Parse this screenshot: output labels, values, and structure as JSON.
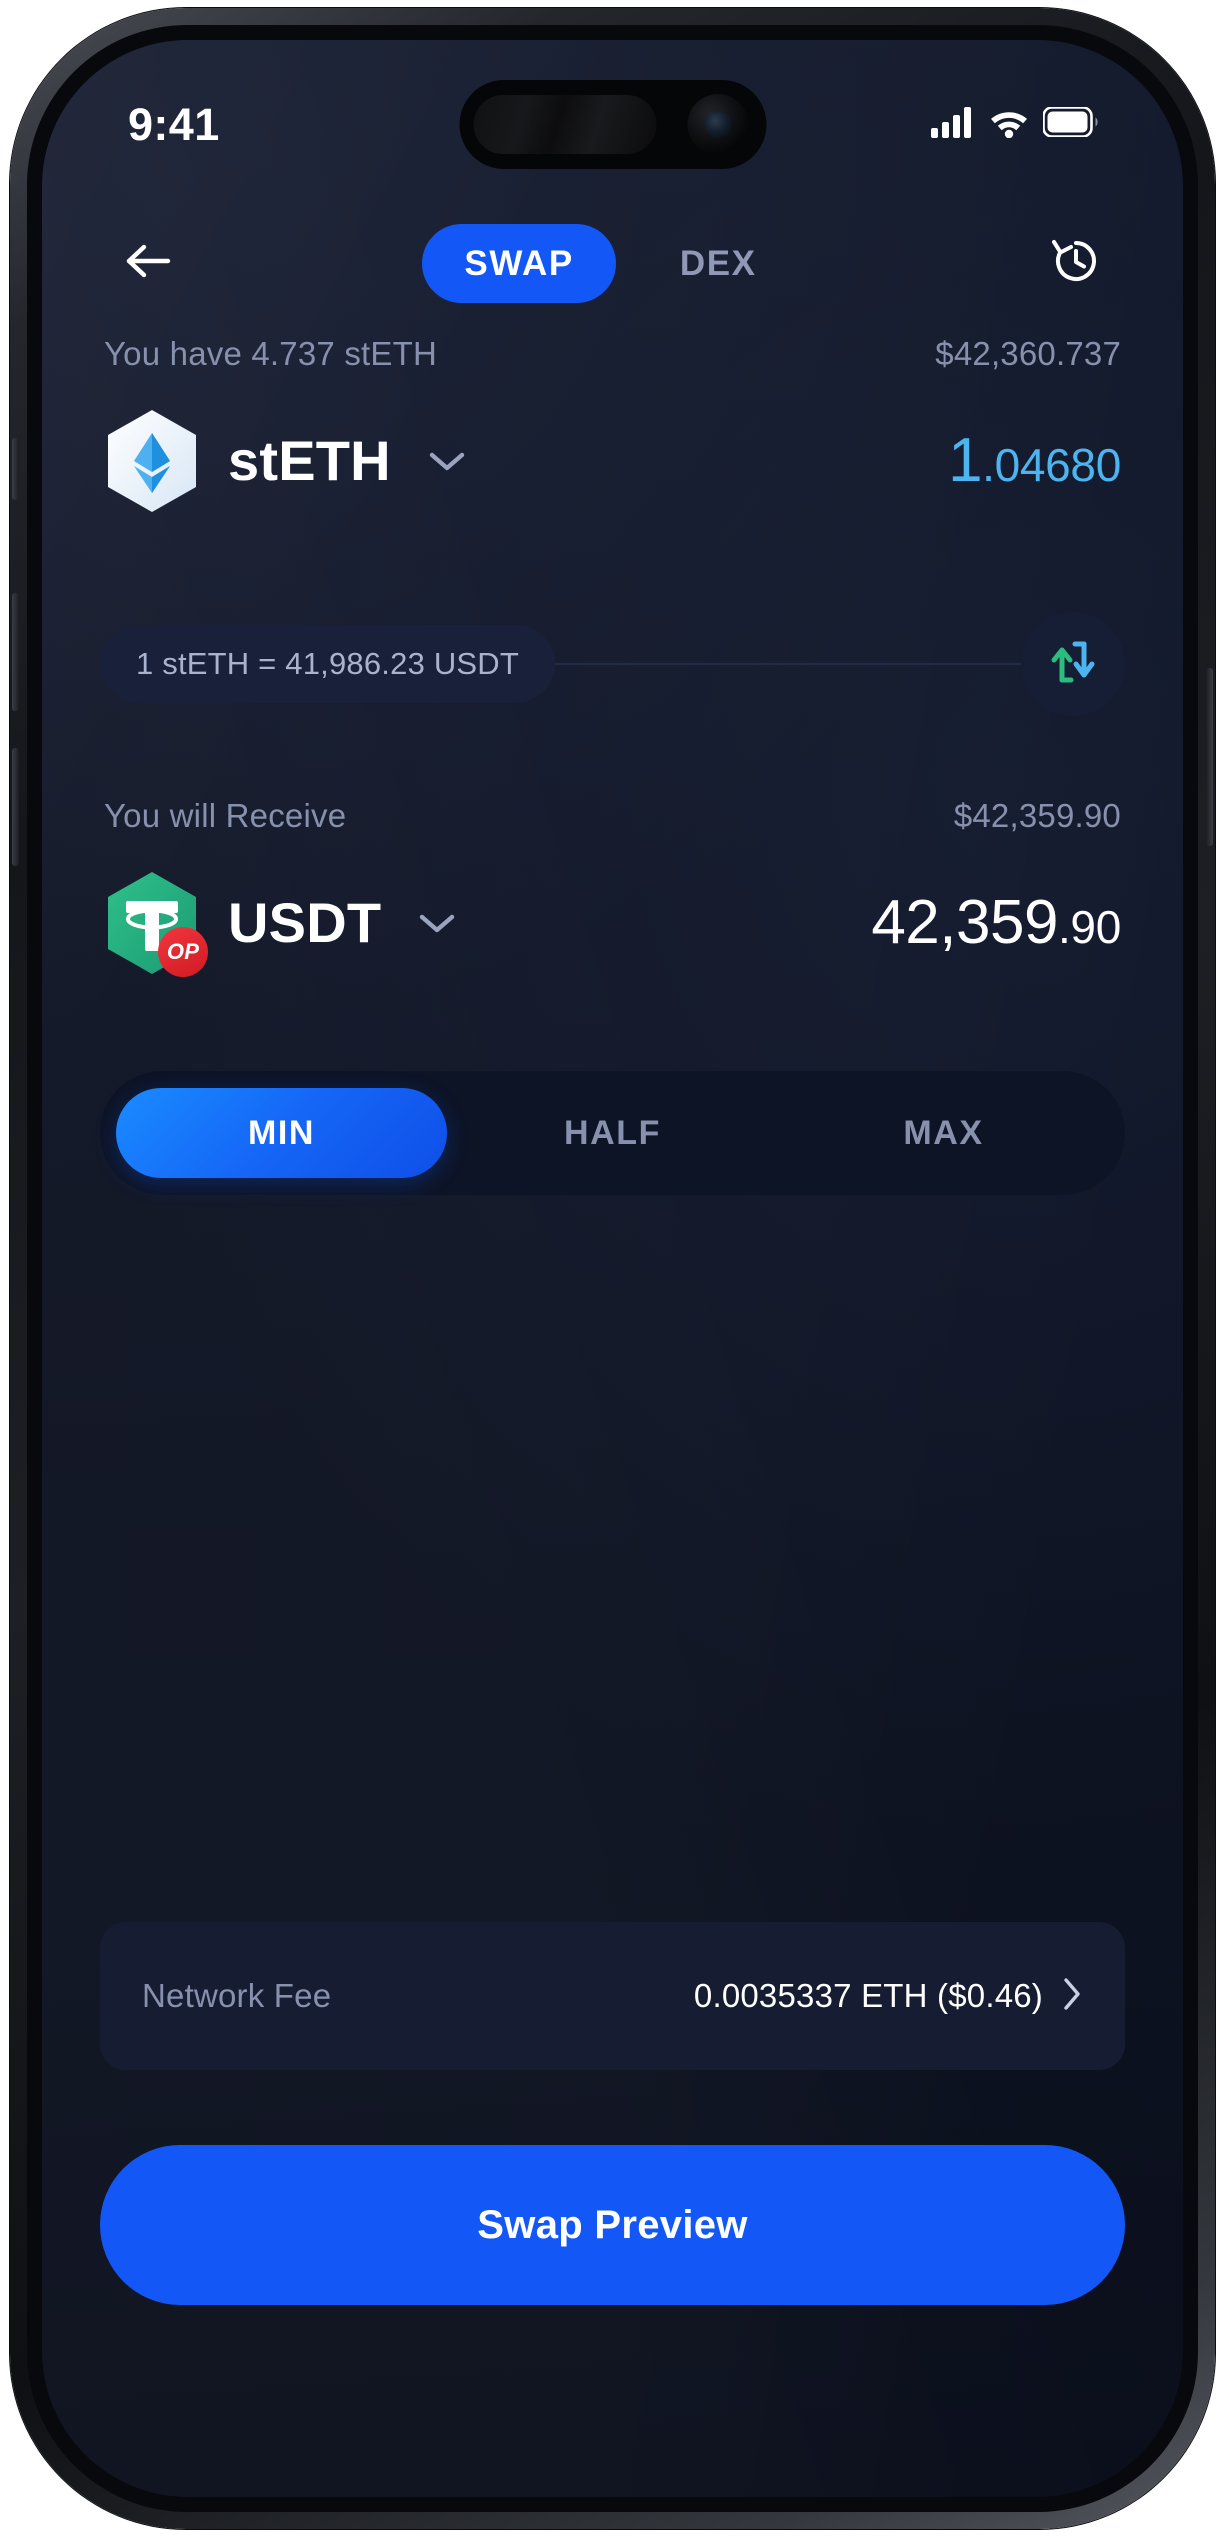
{
  "status_bar": {
    "time": "9:41",
    "signal_icon": "cellular-signal-icon",
    "wifi_icon": "wifi-icon",
    "battery_icon": "battery-icon"
  },
  "header": {
    "back_icon": "back-arrow-icon",
    "history_icon": "history-clock-icon",
    "tabs": [
      {
        "label": "SWAP",
        "active": true
      },
      {
        "label": "DEX",
        "active": false
      }
    ]
  },
  "pay": {
    "balance_label": "You have 4.737 stETH",
    "fiat_value": "$42,360.737",
    "token_symbol": "stETH",
    "token_icon": "lido-steth-icon",
    "chevron_icon": "chevron-down-icon",
    "amount_int": "1",
    "amount_dec": ".04680"
  },
  "rate": {
    "text": "1 stETH = 41,986.23 USDT",
    "swap_icon": "swap-vertical-arrows-icon"
  },
  "receive": {
    "label": "You will Receive",
    "fiat_value": "$42,359.90",
    "token_symbol": "USDT",
    "token_icon": "tether-usdt-icon",
    "network_badge": "OP",
    "chevron_icon": "chevron-down-icon",
    "amount_int": "42,359",
    "amount_dec": ".90"
  },
  "amount_presets": [
    {
      "label": "MIN",
      "active": true
    },
    {
      "label": "HALF",
      "active": false
    },
    {
      "label": "MAX",
      "active": false
    }
  ],
  "network_fee": {
    "label": "Network Fee",
    "value": "0.0035337 ETH ($0.46)",
    "chevron_icon": "chevron-right-icon"
  },
  "cta": {
    "label": "Swap Preview"
  },
  "colors": {
    "accent_blue": "#1358f6",
    "amount_blue": "#4cb4ef",
    "muted_text": "#8791ad",
    "card_bg": "#161d33",
    "screen_bg": "#0e1322",
    "usdt_green": "#26a17b",
    "op_red": "#e8262f",
    "swap_up_green": "#2bbd7e",
    "swap_down_blue": "#4cb4ef"
  }
}
